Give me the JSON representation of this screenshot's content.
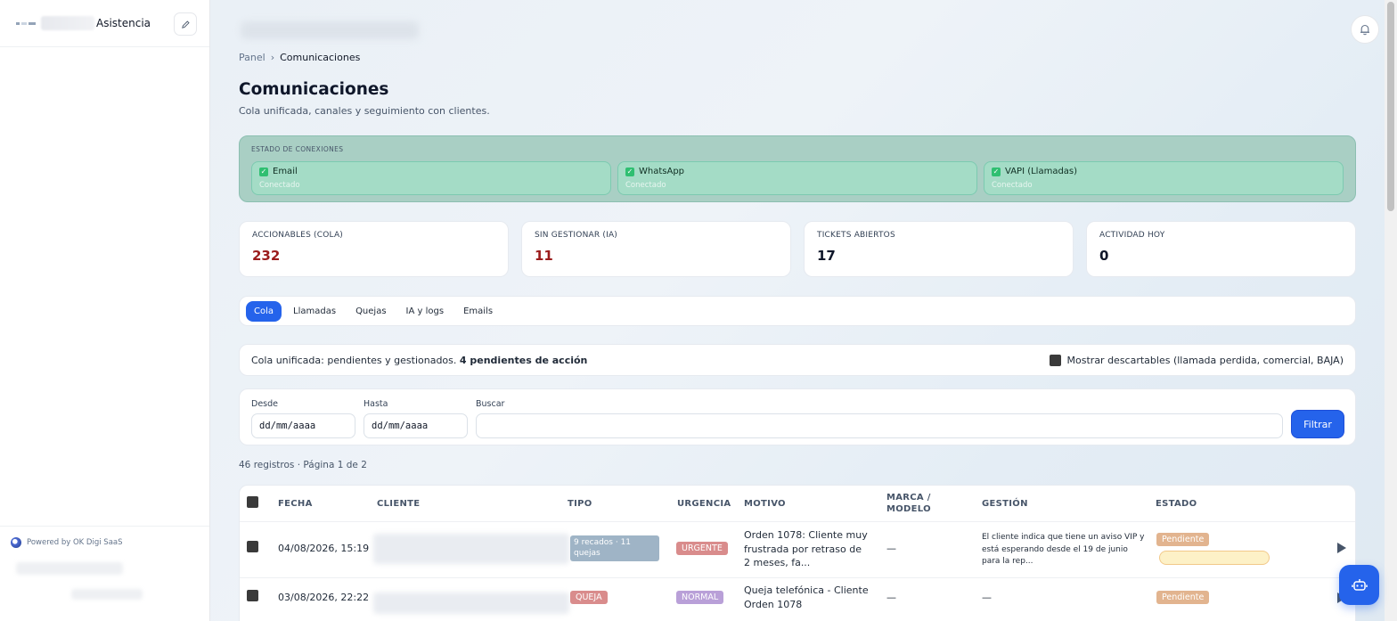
{
  "sidebar": {
    "title": "Asistencia",
    "powered_by": "Powered by OK Digi SaaS"
  },
  "breadcrumb": {
    "root": "Panel",
    "separator": "›",
    "current": "Comunicaciones"
  },
  "page": {
    "title": "Comunicaciones",
    "subtitle": "Cola unificada, canales y seguimiento con clientes."
  },
  "connections": {
    "label": "ESTADO DE CONEXIONES",
    "items": [
      {
        "name": "Email",
        "status": "Conectado"
      },
      {
        "name": "WhatsApp",
        "status": "Conectado"
      },
      {
        "name": "VAPI (Llamadas)",
        "status": "Conectado"
      }
    ]
  },
  "stats": [
    {
      "label": "ACCIONABLES (COLA)",
      "value": "232",
      "color": "#9b1c1c"
    },
    {
      "label": "SIN GESTIONAR (IA)",
      "value": "11",
      "color": "#9b1c1c"
    },
    {
      "label": "TICKETS ABIERTOS",
      "value": "17",
      "color": "#0f172a"
    },
    {
      "label": "ACTIVIDAD HOY",
      "value": "0",
      "color": "#0f172a"
    }
  ],
  "tabs": [
    "Cola",
    "Llamadas",
    "Quejas",
    "IA y logs",
    "Emails"
  ],
  "summary": {
    "text": "Cola unificada: pendientes y gestionados.",
    "bold": "4 pendientes de acción",
    "checkbox_label": "Mostrar descartables (llamada perdida, comercial, BAJA)"
  },
  "filters": {
    "from_label": "Desde",
    "from_value": "dd/mm/aaaa",
    "to_label": "Hasta",
    "to_value": "dd/mm/aaaa",
    "search_label": "Buscar",
    "search_value": "",
    "button": "Filtrar"
  },
  "records": "46 registros · Página 1 de 2",
  "table": {
    "headers": {
      "fecha": "FECHA",
      "cliente": "CLIENTE",
      "tipo": "TIPO",
      "urgencia": "URGENCIA",
      "motivo": "MOTIVO",
      "marca1": "MARCA /",
      "marca2": "MODELO",
      "gestion": "GESTIÓN",
      "estado": "ESTADO"
    },
    "rows": [
      {
        "fecha": "04/08/2026, 15:19",
        "tipo": "9 recados · 11 quejas",
        "urgencia": "URGENTE",
        "motivo": "Orden 1078: Cliente muy frustrada por retraso de 2 meses, fa...",
        "marca": "—",
        "gestion": "El cliente indica que tiene un aviso VIP y está esperando desde el 19 de junio para la rep...",
        "estado": "Pendiente"
      },
      {
        "fecha": "03/08/2026, 22:22",
        "tipo": "QUEJA",
        "urgencia": "NORMAL",
        "motivo": "Queja telefónica - Cliente Orden 1078",
        "marca": "—",
        "gestion": "—",
        "estado": "Pendiente"
      }
    ]
  },
  "colors": {
    "accent": "#2563eb",
    "urgent": "#d98c8c",
    "normal": "#b9a0d8",
    "queja": "#d98c8c",
    "pending": "#e2b48f",
    "tipo_bg": "#9fb4c6"
  }
}
